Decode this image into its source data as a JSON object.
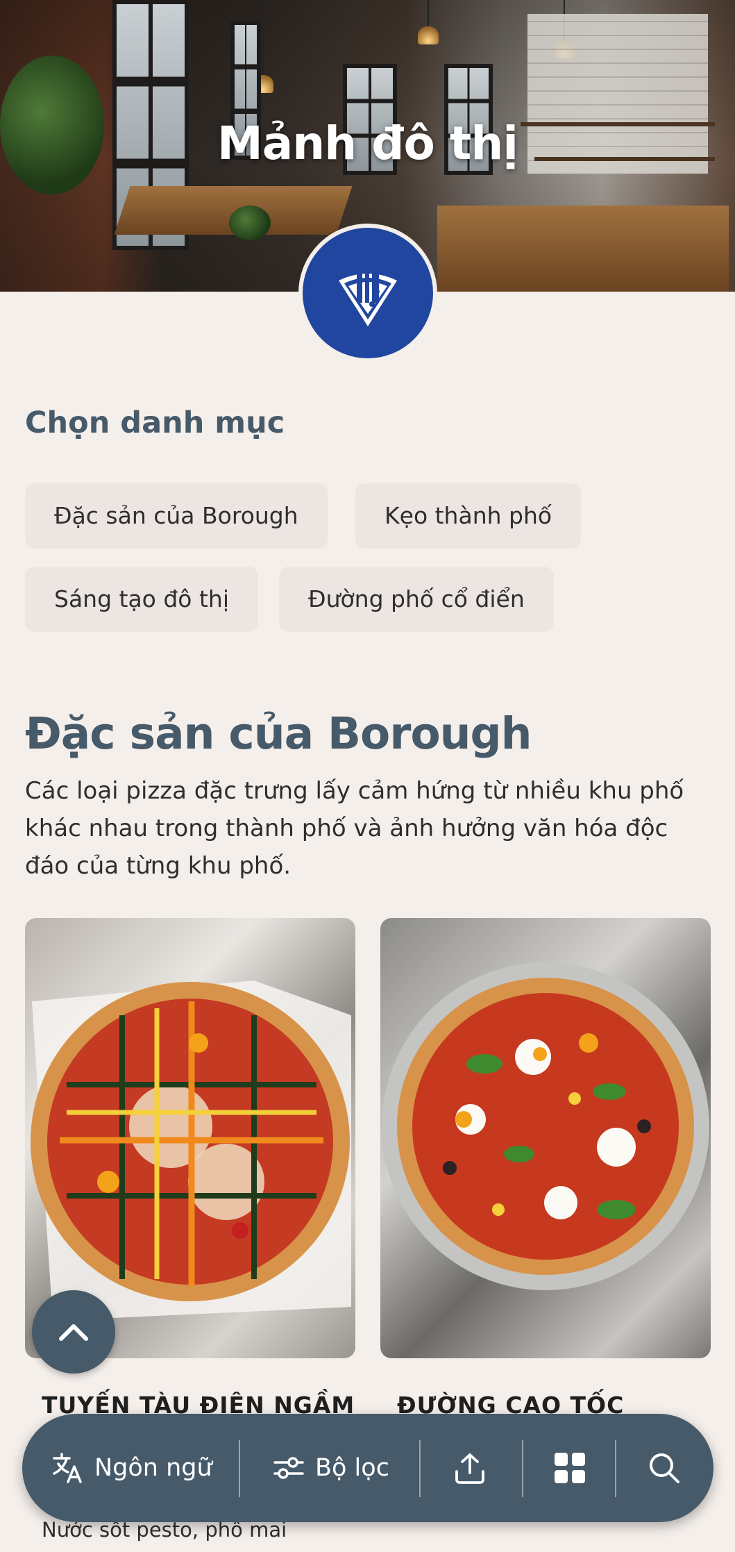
{
  "hero": {
    "title": "Mảnh đô thị"
  },
  "categories": {
    "heading": "Chọn danh mục",
    "items": [
      {
        "label": "Đặc sản của Borough"
      },
      {
        "label": "Kẹo thành phố"
      },
      {
        "label": "Sáng tạo đô thị"
      },
      {
        "label": "Đường phố cổ điển"
      }
    ]
  },
  "section": {
    "title": "Đặc sản của Borough",
    "description": "Các loại pizza đặc trưng lấy cảm hứng từ nhiều khu phố khác nhau trong thành phố và ảnh hưởng văn hóa độc đáo của từng khu phố."
  },
  "cards": [
    {
      "title": "TUYẾN TÀU ĐIỆN NGẦM",
      "description": "Nước sốt pesto, phô mai"
    },
    {
      "title": "ĐƯỜNG CAO TỐC",
      "description": ""
    }
  ],
  "bottom_bar": {
    "language_label": "Ngôn ngữ",
    "filter_label": "Bộ lọc"
  },
  "colors": {
    "accent": "#465a6a",
    "logo_bg": "#2146a0",
    "page_bg": "#f5efeb",
    "chip_bg": "#ece5e1"
  },
  "icons": {
    "language": "translate-icon",
    "filter": "sliders-icon",
    "share": "share-icon",
    "grid": "grid-icon",
    "search": "search-icon",
    "scroll_top": "chevron-up-icon",
    "logo": "pizza-slice-logo"
  }
}
